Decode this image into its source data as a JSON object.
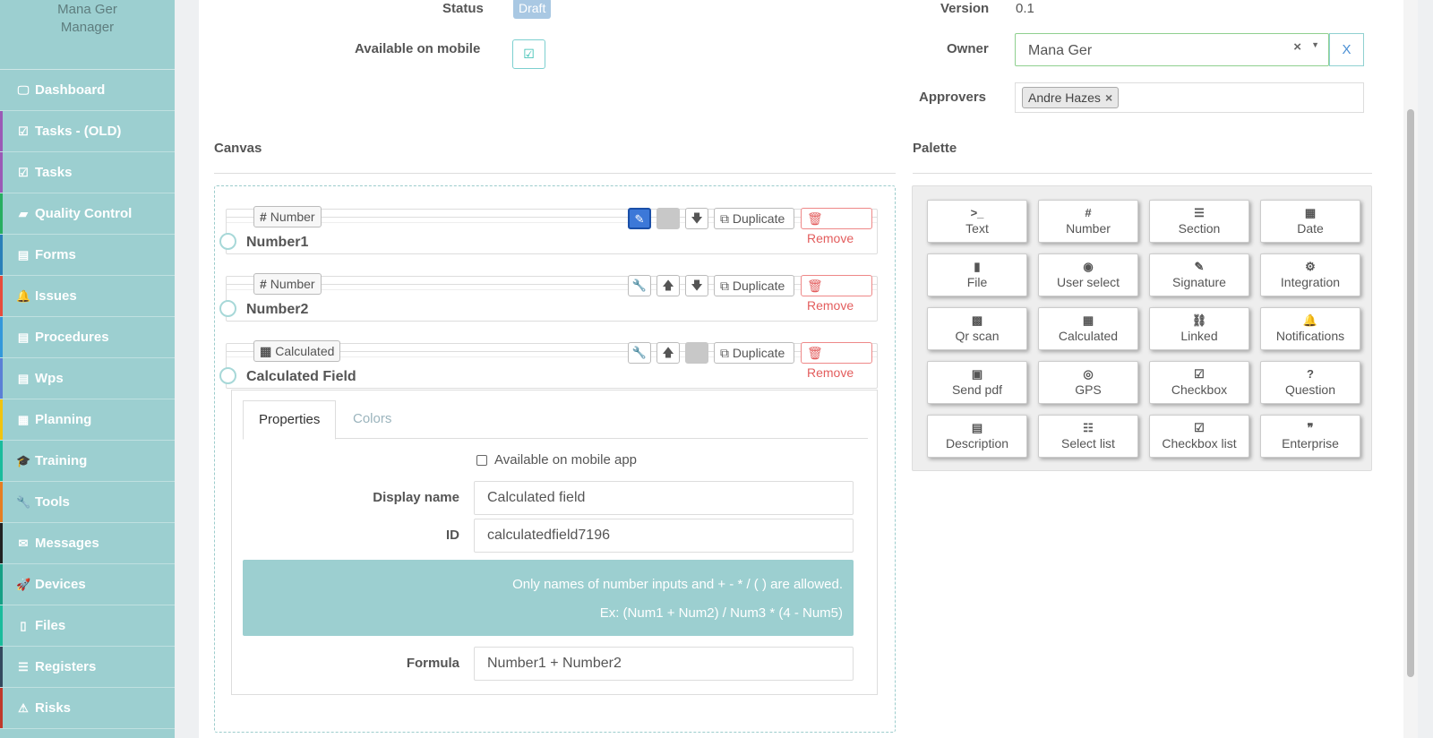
{
  "user": {
    "name": "Mana Ger",
    "role": "Manager"
  },
  "nav": [
    {
      "label": "Dashboard",
      "icon": "🖵",
      "stripe": "#9ccfd0"
    },
    {
      "label": "Tasks - (OLD)",
      "icon": "☑",
      "stripe": "#9b59b6"
    },
    {
      "label": "Tasks",
      "icon": "☑",
      "stripe": "#9b59b6"
    },
    {
      "label": "Quality Control",
      "icon": "▰",
      "stripe": "#27ae60"
    },
    {
      "label": "Forms",
      "icon": "▤",
      "stripe": "#2980b9"
    },
    {
      "label": "Issues",
      "icon": "🔔",
      "stripe": "#e74c3c"
    },
    {
      "label": "Procedures",
      "icon": "▤",
      "stripe": "#3498db"
    },
    {
      "label": "Wps",
      "icon": "▤",
      "stripe": "#5b7fd6"
    },
    {
      "label": "Planning",
      "icon": "▦",
      "stripe": "#f1c40f"
    },
    {
      "label": "Training",
      "icon": "🎓",
      "stripe": "#1abc9c"
    },
    {
      "label": "Tools",
      "icon": "🔧",
      "stripe": "#e67e22"
    },
    {
      "label": "Messages",
      "icon": "✉",
      "stripe": "#222222"
    },
    {
      "label": "Devices",
      "icon": "🚀",
      "stripe": "#16a085"
    },
    {
      "label": "Files",
      "icon": "▯",
      "stripe": "#1abc9c"
    },
    {
      "label": "Registers",
      "icon": "☰",
      "stripe": "#34495e"
    },
    {
      "label": "Risks",
      "icon": "⚠",
      "stripe": "#c0392b"
    }
  ],
  "header": {
    "status_label": "Status",
    "status_value": "Draft",
    "mobile_label": "Available on mobile",
    "mobile_check": "☑",
    "version_label": "Version",
    "version_value": "0.1",
    "owner_label": "Owner",
    "owner_value": "Mana Ger",
    "owner_clear": "×",
    "owner_caret": "▼",
    "owner_button": "X",
    "approvers_label": "Approvers",
    "approver_tag": "Andre Hazes",
    "approver_remove": "×"
  },
  "canvas": {
    "title": "Canvas",
    "duplicate_label": "Duplicate",
    "remove_label": "Remove",
    "fields": [
      {
        "type": "Number",
        "type_icon": "#",
        "name": "Number1"
      },
      {
        "type": "Number",
        "type_icon": "#",
        "name": "Number2"
      },
      {
        "type": "Calculated",
        "type_icon": "▦",
        "name": "Calculated Field"
      }
    ]
  },
  "properties": {
    "tab_properties": "Properties",
    "tab_colors": "Colors",
    "mobile_app_label": "Available on mobile app",
    "display_name_label": "Display name",
    "display_name_value": "Calculated field",
    "id_label": "ID",
    "id_value": "calculatedfield7196",
    "info_line1": "Only names of number inputs and + - * / ( ) are allowed.",
    "info_line2": "Ex: (Num1 + Num2) / Num3 * (4 - Num5)",
    "formula_label": "Formula",
    "formula_value": "Number1 + Number2"
  },
  "palette": {
    "title": "Palette",
    "items": [
      {
        "label": "Text",
        "icon": ">_"
      },
      {
        "label": "Number",
        "icon": "#"
      },
      {
        "label": "Section",
        "icon": "☰"
      },
      {
        "label": "Date",
        "icon": "▦"
      },
      {
        "label": "File",
        "icon": "▮"
      },
      {
        "label": "User select",
        "icon": "◉"
      },
      {
        "label": "Signature",
        "icon": "✎"
      },
      {
        "label": "Integration",
        "icon": "⚙"
      },
      {
        "label": "Qr scan",
        "icon": "▩"
      },
      {
        "label": "Calculated",
        "icon": "▦"
      },
      {
        "label": "Linked",
        "icon": "⛓"
      },
      {
        "label": "Notifications",
        "icon": "🔔"
      },
      {
        "label": "Send pdf",
        "icon": "▣"
      },
      {
        "label": "GPS",
        "icon": "◎"
      },
      {
        "label": "Checkbox",
        "icon": "☑"
      },
      {
        "label": "Question",
        "icon": "?"
      },
      {
        "label": "Description",
        "icon": "▤"
      },
      {
        "label": "Select list",
        "icon": "☷"
      },
      {
        "label": "Checkbox list",
        "icon": "☑"
      },
      {
        "label": "Enterprise",
        "icon": "❞"
      }
    ]
  }
}
